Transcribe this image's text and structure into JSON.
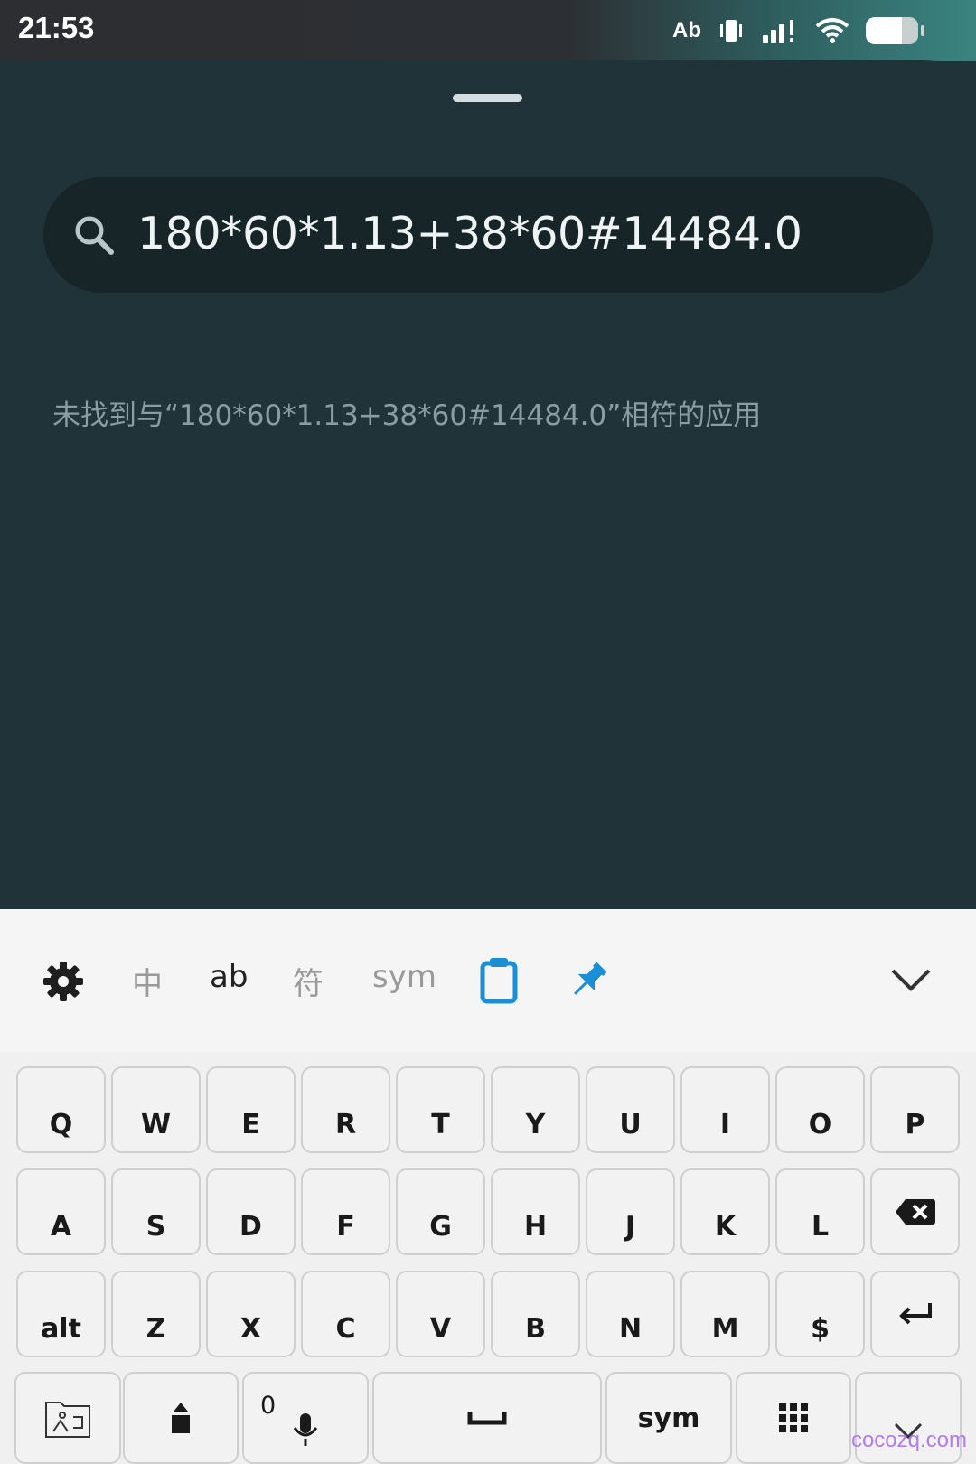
{
  "status_bar": {
    "time": "21:53",
    "indicator_text": "Ab",
    "icons": [
      "vibrate-icon",
      "signal-icon",
      "wifi-icon",
      "battery-icon"
    ]
  },
  "search": {
    "query": "180*60*1.13+38*60#14484.0",
    "icon": "search-icon",
    "no_results": "未找到与“180*60*1.13+38*60#14484.0”相符的应用"
  },
  "keyboard": {
    "toolbar": {
      "settings_icon": "gear-icon",
      "modes": [
        "中",
        "ab",
        "符",
        "sym"
      ],
      "active_mode": "ab",
      "clipboard_icon": "clipboard-icon",
      "pin_icon": "pin-icon",
      "collapse_icon": "chevron-down-icon"
    },
    "rows": [
      [
        "Q",
        "W",
        "E",
        "R",
        "T",
        "Y",
        "U",
        "I",
        "O",
        "P"
      ],
      [
        "A",
        "S",
        "D",
        "F",
        "G",
        "H",
        "J",
        "K",
        "L"
      ],
      [
        "alt",
        "Z",
        "X",
        "C",
        "V",
        "B",
        "N",
        "M",
        "$"
      ]
    ],
    "bottom_row": {
      "mic_key_sub": "0",
      "sym_label": "sym"
    },
    "colors": {
      "accent_blue": "#1a8fd6"
    }
  },
  "watermark": "cocozq.com"
}
